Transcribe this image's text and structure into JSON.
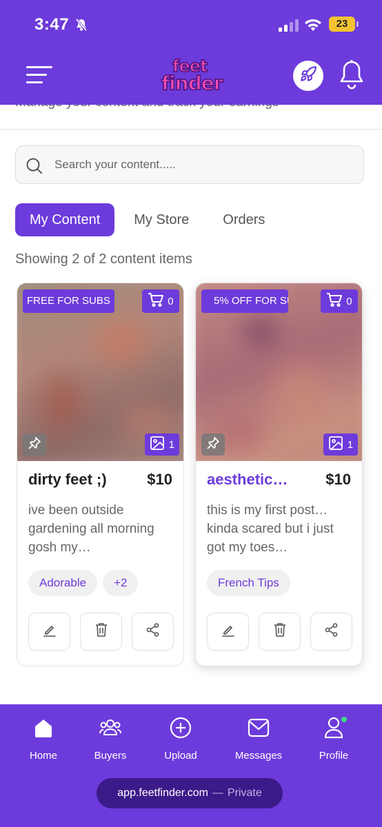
{
  "status_bar": {
    "time": "3:47",
    "battery": "23"
  },
  "header": {
    "logo_line1": "feet",
    "logo_line2": "finder"
  },
  "page": {
    "subtitle": "Manage your content and track your earnings"
  },
  "search": {
    "placeholder": "Search your content....."
  },
  "tabs": [
    {
      "label": "My Content",
      "active": true
    },
    {
      "label": "My Store",
      "active": false
    },
    {
      "label": "Orders",
      "active": false
    }
  ],
  "showing_text": "Showing 2 of 2 content items",
  "cards": [
    {
      "badge": "FREE FOR SUBS",
      "cart_count": "0",
      "image_count": "1",
      "title": "dirty feet ;)",
      "price": "$10",
      "description": "ive been outside gardening all morning gosh my…",
      "tags": [
        "Adorable",
        "+2"
      ]
    },
    {
      "badge": "5% OFF FOR SU",
      "cart_count": "0",
      "image_count": "1",
      "title": "aesthetic…",
      "price": "$10",
      "description": "this is my first post… kinda scared but i just got my toes…",
      "tags": [
        "French Tips"
      ]
    }
  ],
  "bottom_nav": [
    {
      "label": "Home",
      "icon": "home-icon"
    },
    {
      "label": "Buyers",
      "icon": "buyers-icon"
    },
    {
      "label": "Upload",
      "icon": "upload-icon"
    },
    {
      "label": "Messages",
      "icon": "messages-icon"
    },
    {
      "label": "Profile",
      "icon": "profile-icon"
    }
  ],
  "url_bar": {
    "url": "app.feetfinder.com",
    "separator": "—",
    "mode": "Private"
  },
  "colors": {
    "brand": "#6d3bdb",
    "logo_pink": "#ff4fb2",
    "battery": "#f2c230",
    "online_dot": "#3ddc84"
  }
}
